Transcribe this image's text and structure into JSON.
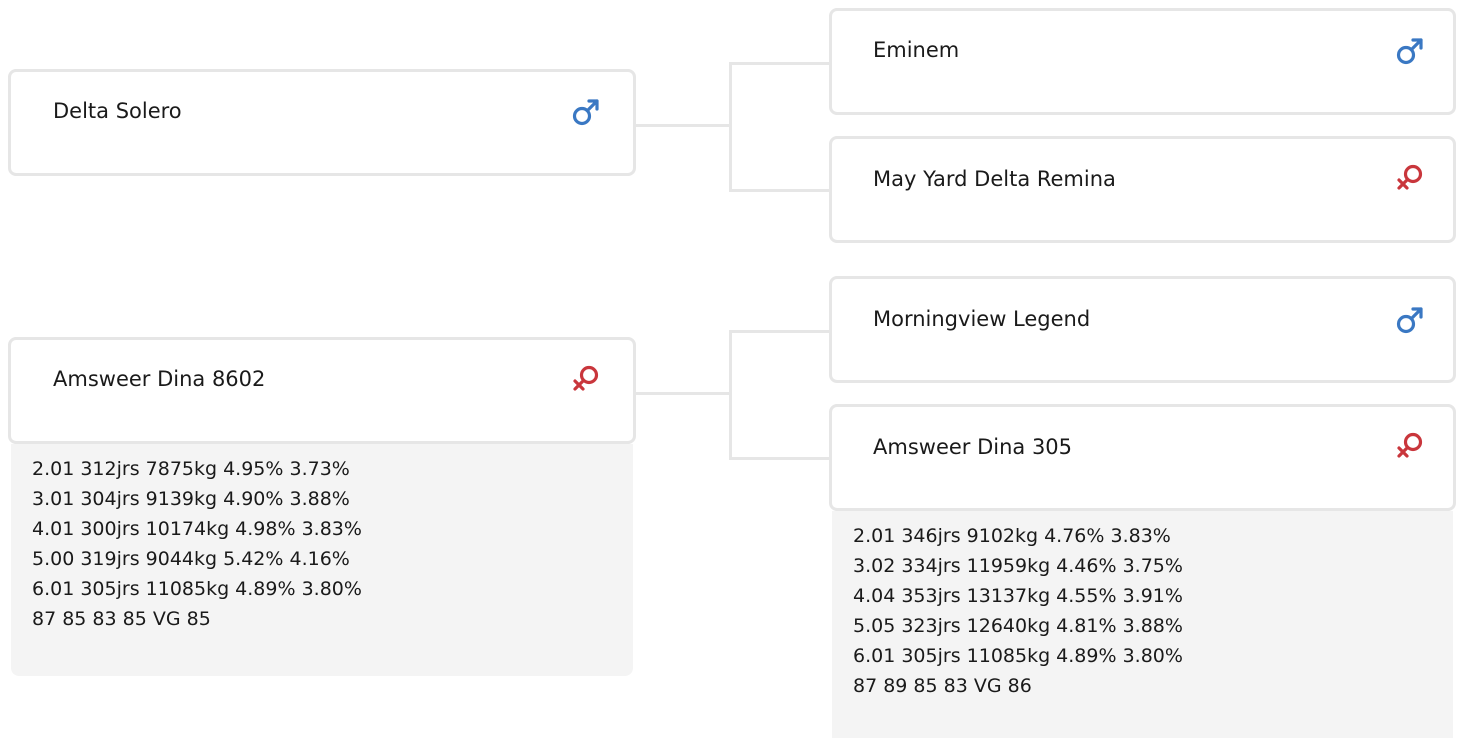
{
  "animals": {
    "sire": {
      "name": "Delta Solero",
      "sex": "male",
      "icon": "male-icon"
    },
    "sire_sire": {
      "name": "Eminem",
      "sex": "male",
      "icon": "male-icon"
    },
    "sire_dam": {
      "name": "May Yard Delta Remina",
      "sex": "female",
      "icon": "female-icon"
    },
    "dam": {
      "name": "Amsweer Dina 8602",
      "sex": "female",
      "icon": "female-icon",
      "stats": [
        "2.01 312jrs 7875kg 4.95% 3.73%",
        "3.01 304jrs 9139kg 4.90% 3.88%",
        "4.01 300jrs 10174kg 4.98% 3.83%",
        "5.00 319jrs 9044kg 5.42% 4.16%",
        "6.01 305jrs 11085kg 4.89% 3.80%",
        "87 85 83 85 VG 85"
      ]
    },
    "dam_sire": {
      "name": "Morningview Legend",
      "sex": "male",
      "icon": "male-icon"
    },
    "dam_dam": {
      "name": "Amsweer Dina 305",
      "sex": "female",
      "icon": "female-icon",
      "stats": [
        "2.01 346jrs 9102kg 4.76% 3.83%",
        "3.02 334jrs 11959kg 4.46% 3.75%",
        "4.04 353jrs 13137kg 4.55% 3.91%",
        "5.05 323jrs 12640kg 4.81% 3.88%",
        "6.01 305jrs 11085kg 4.89% 3.80%",
        "87 89 85 83 VG 86"
      ]
    }
  },
  "colors": {
    "male": "#3a78c3",
    "female": "#c9363c",
    "border": "#e6e6e6",
    "stats_bg": "#f4f4f4"
  }
}
